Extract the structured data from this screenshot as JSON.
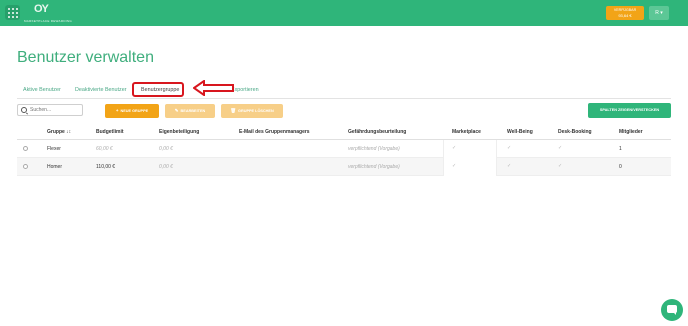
{
  "topbar": {
    "logo_mark": "OY",
    "logo_text": "MARKETPLACE REWARDING",
    "budget_label": "VERFÜGBAR",
    "budget_value": "93,64 €",
    "user_initial": "R ▾"
  },
  "page": {
    "title": "Benutzer verwalten"
  },
  "tabs": [
    {
      "label": "Aktive Benutzer",
      "active": false
    },
    {
      "label": "Deaktivierte Benutzer",
      "active": false
    },
    {
      "label": "Benutzergruppe",
      "active": true
    },
    {
      "label": "Exportieren",
      "active": false
    }
  ],
  "toolbar": {
    "search_placeholder": "Suchen...",
    "new_group": "NEUE GRUPPE",
    "edit": "BEARBEITEN",
    "delete_group": "GRUPPE LÖSCHEN",
    "columns_toggle": "SPALTEN ZEIGEN/VERSTECKEN"
  },
  "table": {
    "headers": {
      "group": "Gruppe ↓↕",
      "budget": "Budgetlimit",
      "own_share": "Eigenbeteiligung",
      "manager_email": "E-Mail des Gruppenmanagers",
      "risk": "Gefährdungsbeurteilung",
      "marketplace": "Marketplace",
      "wellbeing": "Well-Being",
      "desk": "Desk-Booking",
      "members": "Mitglieder"
    },
    "rows": [
      {
        "group": "Flexer",
        "budget": "60,00 €",
        "own_share": "0,00 €",
        "manager_email": "",
        "risk": "verpflichtend (Vorgabe)",
        "marketplace": "✓",
        "wellbeing": "✓",
        "desk": "✓",
        "members": "1"
      },
      {
        "group": "Homer",
        "budget": "110,00 €",
        "own_share": "0,00 €",
        "manager_email": "",
        "risk": "verpflichtend (Vorgabe)",
        "marketplace": "✓",
        "wellbeing": "✓",
        "desk": "✓",
        "members": "0"
      }
    ]
  },
  "colors": {
    "brand": "#2fb57a",
    "accent": "#f2a417",
    "highlight": "#d8161e"
  }
}
